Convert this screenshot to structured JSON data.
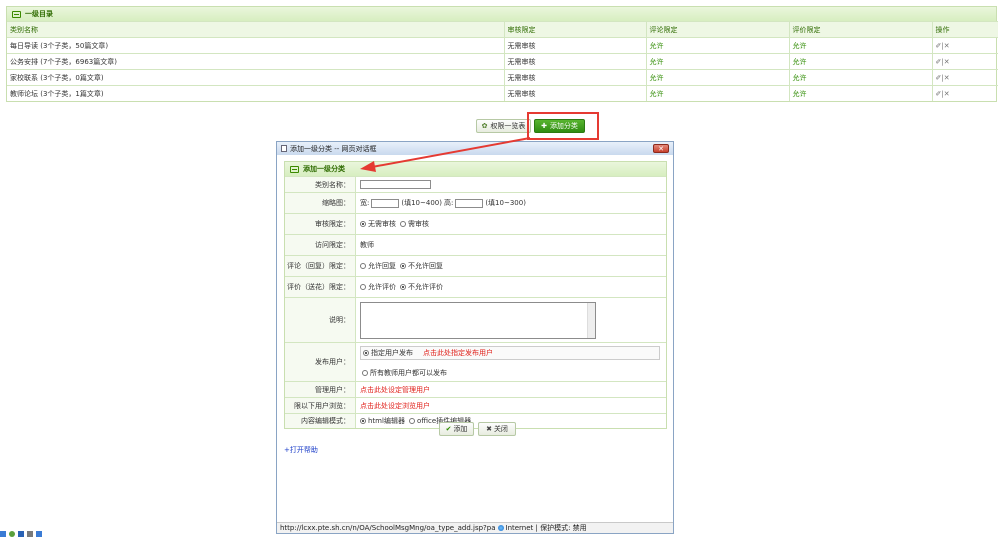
{
  "category_panel": {
    "title": "一级目录",
    "columns": [
      "类别名称",
      "审核限定",
      "评论限定",
      "评价限定",
      "操作"
    ],
    "rows": [
      {
        "name": "每日导读 (3个子类，50篇文章)",
        "review": "无需审核",
        "comment": "允许",
        "rating": "允许",
        "ops": "✐|✕"
      },
      {
        "name": "公务安排 (7个子类，6963篇文章)",
        "review": "无需审核",
        "comment": "允许",
        "rating": "允许",
        "ops": "✐|✕"
      },
      {
        "name": "家校联系 (3个子类，0篇文章)",
        "review": "无需审核",
        "comment": "允许",
        "rating": "允许",
        "ops": "✐|✕"
      },
      {
        "name": "教师论坛 (3个子类，1篇文章)",
        "review": "无需审核",
        "comment": "允许",
        "rating": "允许",
        "ops": "✐|✕"
      }
    ]
  },
  "actions": {
    "permission_list": "权限一览表",
    "add_category": "添加分类"
  },
  "dialog": {
    "title": "添加一级分类 -- 网页对话框",
    "close_symbol": "✕",
    "form_title": "添加一级分类",
    "fields": {
      "category_name": "类别名称：",
      "thumbnail": "缩略图：",
      "thumb_width": "宽:",
      "thumb_width_hint": "(填10~400)",
      "thumb_height": "高:",
      "thumb_height_hint": "(填10~300)",
      "review": "审核限定：",
      "review_opt1": "无需审核",
      "review_opt2": "需审核",
      "access": "访问限定：",
      "access_value": "教师",
      "comment": "评论（回复）限定：",
      "comment_opt1": "允许回复",
      "comment_opt2": "不允许回复",
      "rating": "评价（送花）限定：",
      "rating_opt1": "允许评价",
      "rating_opt2": "不允许评价",
      "description": "说明：",
      "publish_users": "发布用户：",
      "publish_opt1": "指定用户发布",
      "publish_link": "点击此处指定发布用户",
      "publish_opt2": "所有教师用户都可以发布",
      "admin_users": "管理用户：",
      "admin_link": "点击此处设定管理用户",
      "browse_users": "限以下用户浏览：",
      "browse_link": "点击此处设定浏览用户",
      "editor_mode": "内容编辑模式：",
      "editor_opt1": "html编辑器",
      "editor_opt2": "office插件编辑器"
    },
    "submit_label": "添加",
    "close_label": "关闭",
    "help_link": "+打开帮助",
    "status_url": "http://lcxx.pte.sh.cn/n/OA/SchoolMsgMng/oa_type_add.jsp?pa",
    "status_zone": "Internet | 保护模式: 禁用"
  },
  "colors": {
    "accent_green": "#2e8b00",
    "highlight_red": "#e53a32",
    "link_red": "#e0201a"
  }
}
